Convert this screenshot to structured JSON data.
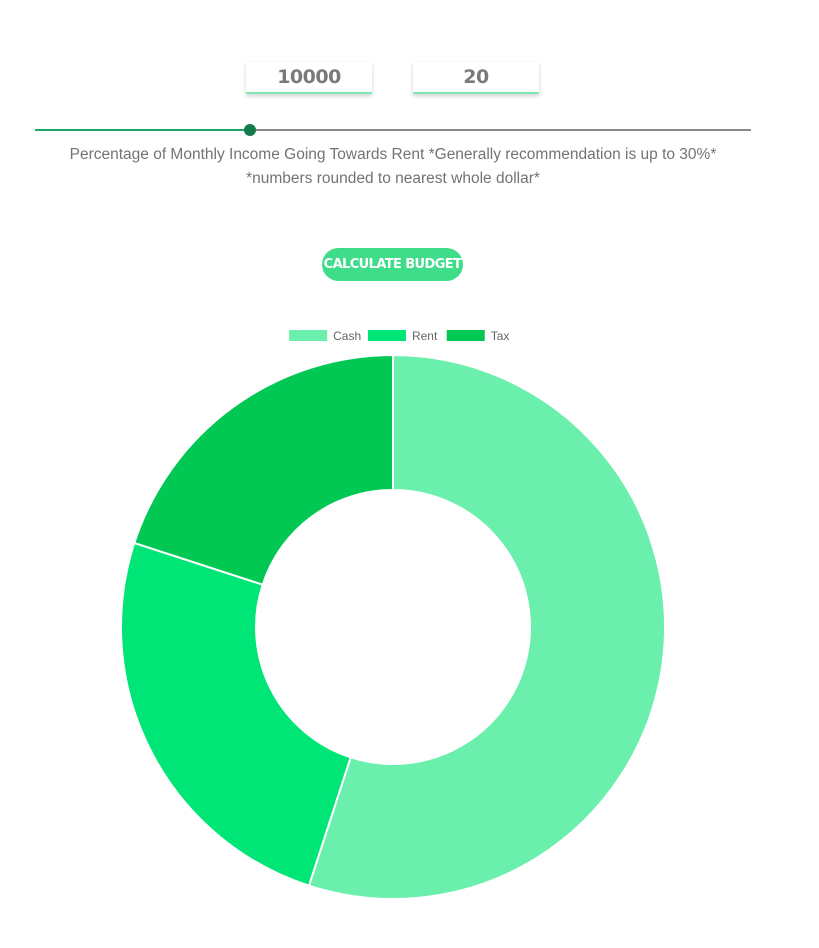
{
  "inputs": {
    "income_value": "10000",
    "years_value": "20"
  },
  "slider": {
    "value_fraction": 0.3
  },
  "captions": {
    "line1": "Percentage of Monthly Income Going Towards Rent *Generally recommendation is up to 30%*",
    "line2": "*numbers rounded to nearest whole dollar*"
  },
  "buttons": {
    "calculate_label": "Calculate Budget"
  },
  "colors": {
    "accent": "#3fdc8a",
    "slider_thumb": "#137a4b"
  },
  "chart_data": {
    "type": "pie",
    "variant": "doughnut",
    "title": "",
    "legend_position": "top",
    "labels": [
      "Cash",
      "Rent",
      "Tax"
    ],
    "values": [
      55,
      25,
      20
    ],
    "colors": [
      "#6af0ac",
      "#00e676",
      "#00c853"
    ]
  }
}
